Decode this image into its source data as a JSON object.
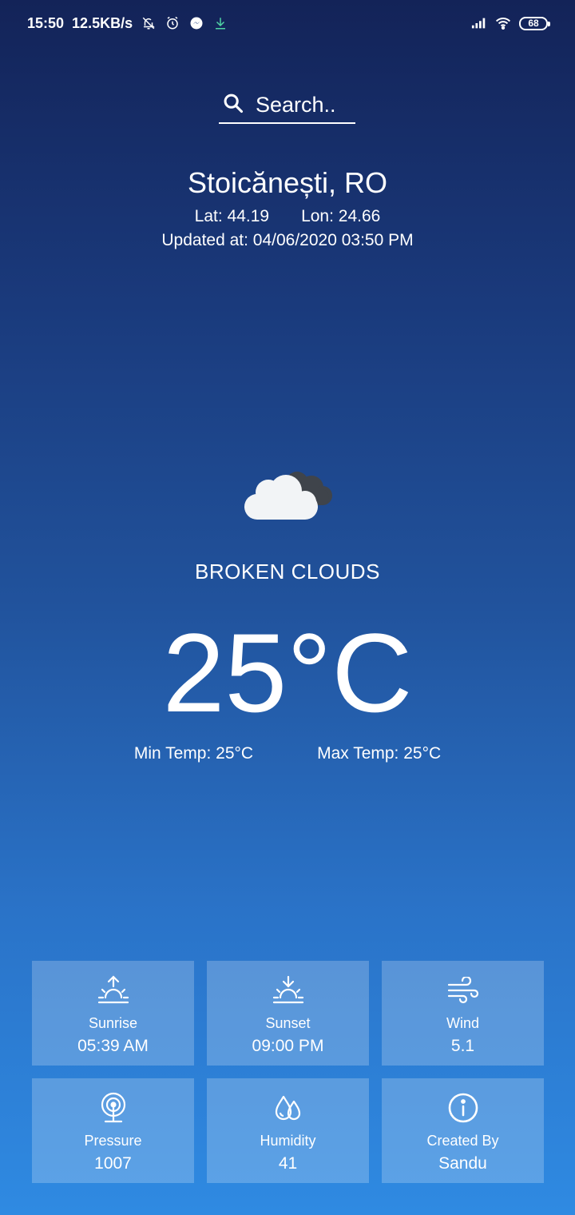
{
  "status_bar": {
    "time": "15:50",
    "speed": "12.5KB/s",
    "battery": "68",
    "icons": [
      "bell-off-icon",
      "alarm-icon",
      "messenger-icon",
      "download-icon",
      "signal-icon",
      "wifi-icon",
      "battery-icon"
    ]
  },
  "search": {
    "label": "Search.."
  },
  "location": {
    "city": "Stoicănești, RO",
    "lat": "Lat: 44.19",
    "lon": "Lon: 24.66",
    "updated": "Updated at: 04/06/2020 03:50 PM"
  },
  "weather": {
    "icon": "broken-clouds-icon",
    "condition": "BROKEN CLOUDS",
    "temperature": "25°C",
    "min_temp": "Min Temp: 25°C",
    "max_temp": "Max Temp: 25°C"
  },
  "details": [
    {
      "icon": "sunrise-icon",
      "label": "Sunrise",
      "value": "05:39 AM"
    },
    {
      "icon": "sunset-icon",
      "label": "Sunset",
      "value": "09:00 PM"
    },
    {
      "icon": "wind-icon",
      "label": "Wind",
      "value": "5.1"
    },
    {
      "icon": "pressure-icon",
      "label": "Pressure",
      "value": "1007"
    },
    {
      "icon": "humidity-icon",
      "label": "Humidity",
      "value": "41"
    },
    {
      "icon": "info-icon",
      "label": "Created By",
      "value": "Sandu"
    }
  ]
}
